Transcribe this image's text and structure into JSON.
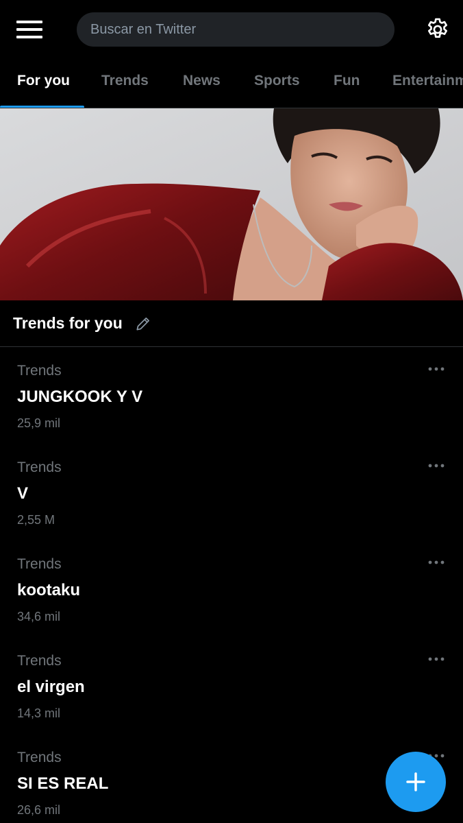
{
  "search": {
    "placeholder": "Buscar en Twitter"
  },
  "tabs": [
    {
      "label": "For you",
      "active": true
    },
    {
      "label": "Trends"
    },
    {
      "label": "News"
    },
    {
      "label": "Sports"
    },
    {
      "label": "Fun"
    },
    {
      "label": "Entertainment"
    }
  ],
  "section": {
    "title": "Trends for you"
  },
  "trends": [
    {
      "category": "Trends",
      "name": "JUNGKOOK Y V",
      "count": "25,9 mil"
    },
    {
      "category": "Trends",
      "name": "V",
      "count": "2,55 M"
    },
    {
      "category": "Trends",
      "name": "kootaku",
      "count": "34,6 mil"
    },
    {
      "category": "Trends",
      "name": "el virgen",
      "count": "14,3 mil"
    },
    {
      "category": "Trends",
      "name": "SI ES REAL",
      "count": "26,6 mil"
    }
  ],
  "colors": {
    "accent": "#1d9bf0",
    "background": "#000000",
    "secondary_text": "#71767b"
  },
  "icons": [
    "menu-icon",
    "gear-icon",
    "pencil-icon",
    "more-icon",
    "plus-icon"
  ]
}
